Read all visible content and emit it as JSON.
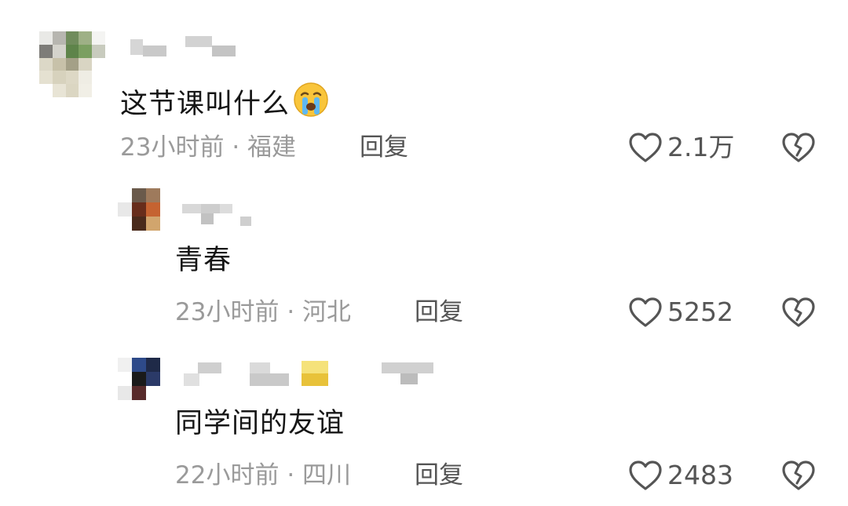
{
  "comments": [
    {
      "text": "这节课叫什么",
      "emoji": "crying-face-emoji",
      "time": "23小时前",
      "separator": "·",
      "location": "福建",
      "reply_label": "回复",
      "likes": "2.1万"
    },
    {
      "text": "青春",
      "time": "23小时前",
      "separator": "·",
      "location": "河北",
      "reply_label": "回复",
      "likes": "5252"
    },
    {
      "text": "同学间的友谊",
      "time": "22小时前",
      "separator": "·",
      "location": "四川",
      "reply_label": "回复",
      "likes": "2483"
    }
  ],
  "icons": {
    "like": "heart-outline-icon",
    "dislike": "broken-heart-icon"
  },
  "colors": {
    "text": "#161616",
    "meta": "#9a9a9a",
    "reply": "#555555",
    "icon": "#555555"
  }
}
